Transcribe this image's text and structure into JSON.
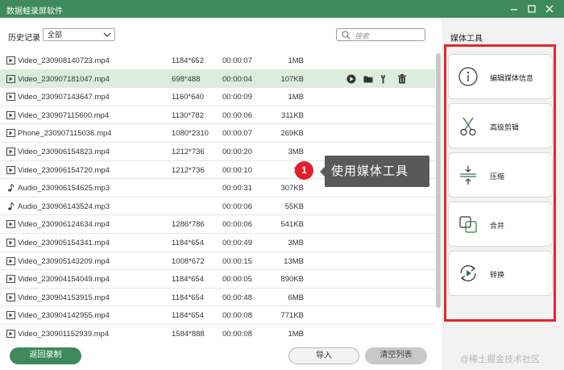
{
  "window": {
    "title": "数据蛙录屏软件",
    "minimize_icon": "minimize-icon",
    "maximize_icon": "maximize-icon",
    "close_icon": "close-icon"
  },
  "filter": {
    "label": "历史记录",
    "selected": "全部",
    "search_placeholder": "搜索"
  },
  "files": [
    {
      "type": "video",
      "name": "Video_230908140723.mp4",
      "resolution": "1184*652",
      "duration": "00:00:07",
      "size": "1MB"
    },
    {
      "type": "video",
      "name": "Video_230907181047.mp4",
      "resolution": "698*488",
      "duration": "00:00:04",
      "size": "107KB",
      "selected": true
    },
    {
      "type": "video",
      "name": "Video_230907143647.mp4",
      "resolution": "1160*640",
      "duration": "00:00:09",
      "size": "1MB"
    },
    {
      "type": "video",
      "name": "Video_230907115600.mp4",
      "resolution": "1130*782",
      "duration": "00:00:06",
      "size": "311KB"
    },
    {
      "type": "video",
      "name": "Phone_230907115036.mp4",
      "resolution": "1080*2310",
      "duration": "00:00:07",
      "size": "269KB"
    },
    {
      "type": "video",
      "name": "Video_230906154823.mp4",
      "resolution": "1212*736",
      "duration": "00:00:20",
      "size": "3MB"
    },
    {
      "type": "video",
      "name": "Video_230906154720.mp4",
      "resolution": "1212*736",
      "duration": "00:00:10",
      "size": "1M"
    },
    {
      "type": "audio",
      "name": "Audio_230906154625.mp3",
      "resolution": "",
      "duration": "00:00:31",
      "size": "307KB"
    },
    {
      "type": "audio",
      "name": "Audio_230906143524.mp3",
      "resolution": "",
      "duration": "00:00:06",
      "size": "55KB"
    },
    {
      "type": "video",
      "name": "Video_230906124634.mp4",
      "resolution": "1286*786",
      "duration": "00:00:06",
      "size": "541KB"
    },
    {
      "type": "video",
      "name": "Video_230905154341.mp4",
      "resolution": "1184*654",
      "duration": "00:00:49",
      "size": "3MB"
    },
    {
      "type": "video",
      "name": "Video_230905143209.mp4",
      "resolution": "1008*672",
      "duration": "00:00:15",
      "size": "13MB"
    },
    {
      "type": "video",
      "name": "Video_230904154049.mp4",
      "resolution": "1184*654",
      "duration": "00:00:05",
      "size": "890KB"
    },
    {
      "type": "video",
      "name": "Video_230904153915.mp4",
      "resolution": "1184*654",
      "duration": "00:00:48",
      "size": "6MB"
    },
    {
      "type": "video",
      "name": "Video_230904142955.mp4",
      "resolution": "1184*654",
      "duration": "00:00:08",
      "size": "771KB"
    },
    {
      "type": "video",
      "name": "Video_230901152939.mp4",
      "resolution": "1584*888",
      "duration": "00:00:08",
      "size": "1MB"
    }
  ],
  "row_actions": [
    "play-icon",
    "folder-icon",
    "wrench-icon",
    "trash-icon"
  ],
  "tooltip": {
    "badge": "1",
    "text": "使用媒体工具"
  },
  "media_tools": {
    "title": "媒体工具",
    "items": [
      {
        "label": "编辑媒体信息",
        "icon": "info-icon"
      },
      {
        "label": "高级剪辑",
        "icon": "scissors-icon"
      },
      {
        "label": "压缩",
        "icon": "compress-icon"
      },
      {
        "label": "合并",
        "icon": "merge-icon"
      },
      {
        "label": "转换",
        "icon": "convert-icon"
      }
    ]
  },
  "buttons": {
    "back": "返回录制",
    "import": "导入",
    "clear": "清空列表"
  },
  "watermark": "@稀土掘金技术社区",
  "colors": {
    "brand_green": "#3e8a5c",
    "selected_row": "#dbeedd",
    "highlight_red": "#e7262e",
    "badge_red": "#e01f2a"
  }
}
